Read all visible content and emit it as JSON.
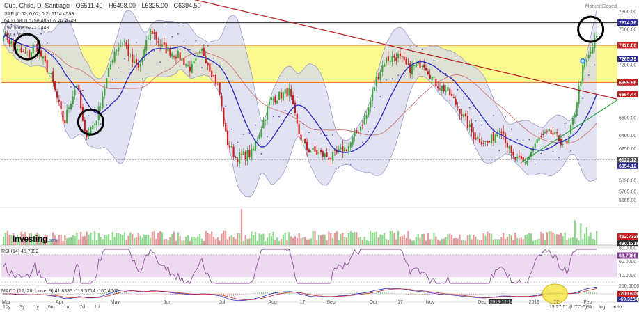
{
  "header": {
    "title": "Cup, Chile, D, Santiago",
    "open": "O6511.40",
    "high": "H6498.00",
    "low": "L6325.00",
    "close": "C6394.50",
    "market_status": "Market Closed"
  },
  "indicator_labels": {
    "sar": "SAR (0.02, 0.02, 0.2)",
    "sar_value": "6114.4593",
    "row2": "6400.5800  6758.4851  6042.4749",
    "row3": "197.5668  6271.2443",
    "bb_value": "6319.6590",
    "rsi": "RSI (14)",
    "rsi_value": "45.7392",
    "macd": "MACD (12, 26, close, 9)",
    "macd_values": "41.8335  -118.5714  -160.4049"
  },
  "logo": {
    "brand": "Investing",
    "suffix": ".com"
  },
  "timeframes": [
    "10y",
    "3y",
    "1y",
    "6m",
    "1m",
    "7d",
    "1d"
  ],
  "clock": "13:27:51 (UTC-5)",
  "options": [
    "%",
    "log",
    "auto"
  ],
  "colors": {
    "up": "#3ca63c",
    "down": "#c81f1f",
    "bb_fill": "#d7d8ee",
    "bb_line": "#8f8fc4",
    "ma_blue": "#2d2dbf",
    "ma_red": "#d07070",
    "zone_yellow": "#fbfa90",
    "zone_line": "#e0741a",
    "trend_red": "#b01e1e",
    "trend_green": "#2aa040",
    "rsi_fill": "#ecdaf0",
    "rsi_line": "#8a4e96",
    "macd_line": "#2d2dbf",
    "signal_line": "#c03030",
    "highlight": "#f7e64a"
  },
  "chart_data": [
    {
      "type": "candlestick",
      "title": "Cup, Chile, D, Santiago",
      "x_tick_labels": [
        "Mar",
        "Apr",
        "May",
        "Jun",
        "Jul",
        "Aug",
        "17",
        "Sep",
        "Oct",
        "17",
        "Nov",
        "Dec",
        "2018-12-14",
        "2019",
        "17",
        "Feb"
      ],
      "y_tick_labels": [
        "7800.00",
        "7600.00",
        "7420.00",
        "7265.75",
        "7200.00",
        "6999.96",
        "6864.44",
        "6600.00",
        "6400.00",
        "6250.00",
        "6122.12",
        "6054.12",
        "5890.00",
        "5765.00",
        "5665.00"
      ],
      "ylim": [
        5600,
        7900
      ],
      "price_markers": [
        {
          "label": "7674.76",
          "value": 7675,
          "color": "#2e2e9a",
          "role": "upper band"
        },
        {
          "label": "7420.00",
          "value": 7420,
          "color": "#c81f1f",
          "role": "zone top"
        },
        {
          "label": "7265.79",
          "value": 7266,
          "color": "#2e2e9a",
          "role": "moving average"
        },
        {
          "label": "6999.96",
          "value": 7000,
          "color": "#c81f1f",
          "role": "zone bottom"
        },
        {
          "label": "6864.44",
          "value": 6864,
          "color": "#c81f1f",
          "role": "resistance"
        },
        {
          "label": "6122.12",
          "value": 6122,
          "color": "#555555",
          "role": "support"
        },
        {
          "label": "6054.12",
          "value": 6054,
          "color": "#2e2e9a",
          "role": "lower band"
        }
      ],
      "horizontal_lines": [
        {
          "value": 7675,
          "color": "#222222"
        },
        {
          "value": 7420,
          "color": "#e0741a"
        },
        {
          "value": 6999,
          "color": "#e0741a"
        }
      ],
      "support_zone": [
        6999,
        7420
      ],
      "trendlines": [
        {
          "color": "#b01e1e",
          "points": [
            [
              0.28,
              7990
            ],
            [
              1.0,
              6810
            ]
          ]
        },
        {
          "color": "#2aa040",
          "points": [
            [
              0.843,
              6090
            ],
            [
              1.0,
              6800
            ]
          ]
        }
      ],
      "close_anchors": [
        [
          0,
          7560
        ],
        [
          15,
          7350
        ],
        [
          28,
          7300
        ],
        [
          34,
          7450
        ],
        [
          52,
          7050
        ],
        [
          66,
          6520
        ],
        [
          70,
          6700
        ],
        [
          80,
          7000
        ],
        [
          88,
          6400
        ],
        [
          100,
          6550
        ],
        [
          120,
          7350
        ],
        [
          131,
          7480
        ],
        [
          138,
          7250
        ],
        [
          147,
          7150
        ],
        [
          160,
          7600
        ],
        [
          172,
          7400
        ],
        [
          190,
          7300
        ],
        [
          204,
          7150
        ],
        [
          216,
          7360
        ],
        [
          234,
          6920
        ],
        [
          242,
          6350
        ],
        [
          252,
          6150
        ],
        [
          270,
          6200
        ],
        [
          290,
          6800
        ],
        [
          310,
          6900
        ],
        [
          320,
          6450
        ],
        [
          328,
          6250
        ],
        [
          340,
          6200
        ],
        [
          356,
          6150
        ],
        [
          375,
          6280
        ],
        [
          394,
          6620
        ],
        [
          404,
          7010
        ],
        [
          414,
          7250
        ],
        [
          428,
          7300
        ],
        [
          440,
          7150
        ],
        [
          456,
          7230
        ],
        [
          468,
          7000
        ],
        [
          482,
          6900
        ],
        [
          496,
          6680
        ],
        [
          510,
          6400
        ],
        [
          526,
          6300
        ],
        [
          540,
          6500
        ],
        [
          552,
          6150
        ],
        [
          566,
          6080
        ],
        [
          580,
          6350
        ],
        [
          594,
          6430
        ],
        [
          612,
          6280
        ],
        [
          620,
          6650
        ],
        [
          628,
          7130
        ],
        [
          636,
          7300
        ],
        [
          644,
          7520
        ]
      ],
      "price_label_positions": [
        1.0
      ],
      "candle_count": 300,
      "highlight_circles": [
        "early high",
        "second high",
        "latest high"
      ],
      "subplots": [
        {
          "type": "volume",
          "label": "Volume",
          "markers": [
            "452.733K",
            "430.131K"
          ]
        },
        {
          "type": "line",
          "label": "RSI (14)",
          "ylim": [
            25,
            80
          ],
          "y_tick_labels": [
            "80.0000",
            "60.0000",
            "40.0000"
          ],
          "marker": "68.7966",
          "bands": [
            30,
            70
          ]
        },
        {
          "type": "macd",
          "label": "MACD (12, 26, close, 9)",
          "y_tick_labels": [
            "250.0000",
            "-250.0000"
          ],
          "markers": [
            "-200.6084",
            "-69.3284"
          ]
        }
      ]
    }
  ]
}
